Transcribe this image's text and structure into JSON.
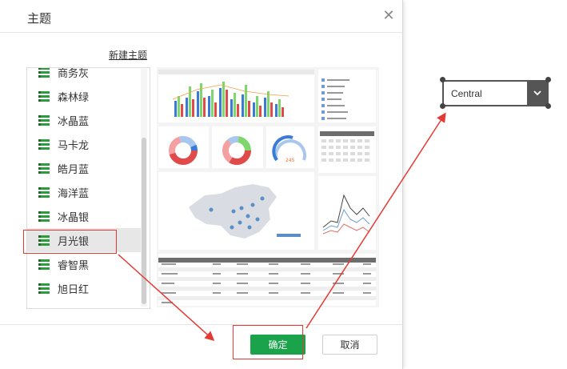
{
  "dialog": {
    "title": "主题",
    "new_theme_label": "新建主题",
    "ok_label": "确定",
    "cancel_label": "取消",
    "selected_theme": "月光银"
  },
  "themes": [
    {
      "label": "商务灰"
    },
    {
      "label": "森林绿"
    },
    {
      "label": "冰晶蓝"
    },
    {
      "label": "马卡龙"
    },
    {
      "label": "皓月蓝"
    },
    {
      "label": "海洋蓝"
    },
    {
      "label": "冰晶银"
    },
    {
      "label": "月光银"
    },
    {
      "label": "睿智黑"
    },
    {
      "label": "旭日红"
    }
  ],
  "dropdown": {
    "value": "Central"
  },
  "colors": {
    "accent_green": "#1aa34a",
    "annotation_red": "#e53935"
  }
}
